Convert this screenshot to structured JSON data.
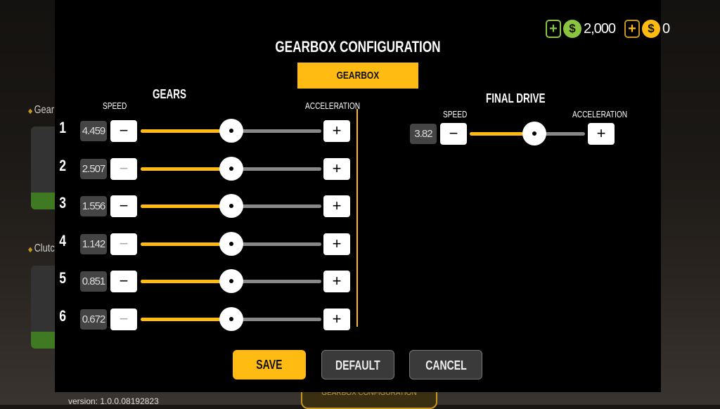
{
  "background": {
    "side_labels": [
      "Gear",
      "Clutch"
    ],
    "version": "version: 1.0.0.08192823",
    "bottom_button": "GEARBOX CONFIGURATION"
  },
  "currency": [
    {
      "icon": "green-cash-icon",
      "color": "#8bc53f",
      "amount": "2,000"
    },
    {
      "icon": "gold-coin-icon",
      "color": "#ffbb12",
      "amount": "0"
    }
  ],
  "dialog": {
    "title": "GEARBOX CONFIGURATION",
    "tab": "GEARBOX",
    "gears": {
      "title": "GEARS",
      "speed_label": "SPEED",
      "accel_label": "ACCELERATION",
      "rows": [
        {
          "n": "1",
          "value": "4.459",
          "position": 0.5,
          "minus_enabled": true
        },
        {
          "n": "2",
          "value": "2.507",
          "position": 0.5,
          "minus_enabled": false
        },
        {
          "n": "3",
          "value": "1.556",
          "position": 0.5,
          "minus_enabled": true
        },
        {
          "n": "4",
          "value": "1.142",
          "position": 0.5,
          "minus_enabled": false
        },
        {
          "n": "5",
          "value": "0.851",
          "position": 0.5,
          "minus_enabled": true
        },
        {
          "n": "6",
          "value": "0.672",
          "position": 0.5,
          "minus_enabled": false
        }
      ]
    },
    "final_drive": {
      "title": "FINAL DRIVE",
      "speed_label": "SPEED",
      "accel_label": "ACCELERATION",
      "value": "3.82",
      "position": 0.56
    },
    "buttons": {
      "minus": "−",
      "plus": "+",
      "save": "SAVE",
      "default": "DEFAULT",
      "cancel": "CANCEL"
    },
    "accent": "#ffbb12"
  }
}
